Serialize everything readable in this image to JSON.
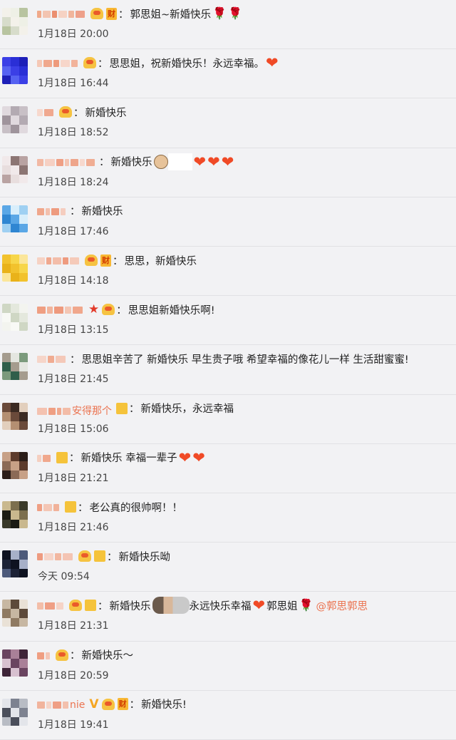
{
  "comments": [
    {
      "name_hint": "",
      "badges": [
        "vip",
        "cai"
      ],
      "text": "郭思姐~新婚快乐",
      "emojis": [
        "rose",
        "rose"
      ],
      "time": "1月18日 20:00",
      "avatar": [
        "#f3f1ea",
        "#d7dccb",
        "#b8c4a0",
        "#eef0e6"
      ],
      "name_blocks": [
        "#f0a98a",
        "#f3c4b1",
        "#eb8f70",
        "#f6d2c3",
        "#f1b59c",
        "#eea08a"
      ]
    },
    {
      "name_hint": "",
      "badges": [
        "vip"
      ],
      "text": "思思姐，祝新婚快乐！永远幸福。",
      "emojis": [
        "heart"
      ],
      "time": "1月18日 16:44",
      "avatar": [
        "#2a2fd6",
        "#3b3fe6",
        "#5662f2",
        "#1d1fb8"
      ],
      "name_blocks": [
        "#f5c8b6",
        "#f0a88d",
        "#ee9a7c",
        "#f7d6ca",
        "#f2b39b"
      ]
    },
    {
      "name_hint": "",
      "badges": [
        "vip"
      ],
      "text": "新婚快乐",
      "emojis": [],
      "time": "1月18日 18:52",
      "avatar": [
        "#c8c0c6",
        "#b3aab2",
        "#e0d9de",
        "#9f949c"
      ],
      "name_blocks": [
        "#f7d8cd",
        "#f0a88f"
      ]
    },
    {
      "name_hint": "",
      "badges": [],
      "text": "新婚快乐",
      "emojis": [
        "face",
        "whitebox",
        "heart",
        "heart",
        "heart"
      ],
      "time": "1月18日 18:24",
      "avatar": [
        "#e8dede",
        "#b9a3a2",
        "#8c7573",
        "#f1e9ea"
      ],
      "name_blocks": [
        "#f2b9a4",
        "#f6d0c3",
        "#ef9f84",
        "#f4c4b2",
        "#eea58b",
        "#f7d8cd",
        "#f0ad93"
      ]
    },
    {
      "name_hint": "",
      "badges": [],
      "text": "新婚快乐",
      "emojis": [],
      "time": "1月18日 17:46",
      "avatar": [
        "#5aa7e6",
        "#2f86d2",
        "#9fd0f2",
        "#d8eefb"
      ],
      "name_blocks": [
        "#f0a78c",
        "#f3c0ad",
        "#ee9b7f",
        "#f5cdbf"
      ]
    },
    {
      "name_hint": "",
      "badges": [
        "vip",
        "cai"
      ],
      "text": "思思，新婚快乐",
      "emojis": [],
      "time": "1月18日 14:18",
      "avatar": [
        "#f7d64a",
        "#f2c22d",
        "#e9b21a",
        "#fbe69a"
      ],
      "name_blocks": [
        "#f6d2c4",
        "#f0a88e",
        "#f3bda9",
        "#ee9b7f",
        "#f5cab9"
      ]
    },
    {
      "name_hint": "",
      "badges": [
        "star",
        "vip"
      ],
      "text": "思思姐新婚快乐啊!",
      "emojis": [],
      "time": "1月18日 13:15",
      "avatar": [
        "#f3f4ef",
        "#e4e8dd",
        "#cfd7c4",
        "#f8f9f5"
      ],
      "name_blocks": [
        "#ef9e82",
        "#f2b49c",
        "#ee9a7e",
        "#f4c6b4",
        "#f0a78c"
      ]
    },
    {
      "name_hint": "",
      "badges": [],
      "text": "思思姐辛苦了 新婚快乐  早生贵子哦  希望幸福的像花儿一样 生活甜蜜蜜!",
      "emojis": [],
      "time": "1月18日 21:45",
      "avatar": [
        "#2f5e4a",
        "#7b9a7c",
        "#e4e6e0",
        "#a59c8e"
      ],
      "name_blocks": [
        "#f6d5c9",
        "#f0ab91",
        "#f4c8b8"
      ]
    },
    {
      "name_hint": "",
      "badges": [
        "sq"
      ],
      "text": "新婚快乐，永远幸福",
      "emojis": [],
      "time": "1月18日 15:06",
      "avatar": [
        "#6a4a3a",
        "#b48f72",
        "#e2cfbd",
        "#3b2a22"
      ],
      "name_blocks": [
        "#f4c2b0",
        "#ef9f83",
        "#f0a88e",
        "#f3bca7"
      ],
      "name_text": "安得那个"
    },
    {
      "name_hint": "",
      "badges": [
        "sq"
      ],
      "text": "新婚快乐 幸福一辈子",
      "emojis": [
        "heart",
        "heart"
      ],
      "time": "1月18日 21:21",
      "avatar": [
        "#5c3b2c",
        "#c7a086",
        "#8b6a56",
        "#2b1d18"
      ],
      "name_blocks": [
        "#f5cfc0",
        "#f0a88d"
      ]
    },
    {
      "name_hint": "",
      "badges": [
        "sq"
      ],
      "text": "老公真的很帅啊！！",
      "emojis": [],
      "time": "1月18日 21:46",
      "avatar": [
        "#3a3a2a",
        "#7c6f4e",
        "#c9b88e",
        "#1b1b14"
      ],
      "name_blocks": [
        "#ef9f84",
        "#f4c6b5",
        "#f1b29a"
      ]
    },
    {
      "name_hint": "",
      "badges": [
        "vip",
        "sq"
      ],
      "text": "新婚快乐呦",
      "emojis": [],
      "time": "今天 09:54",
      "avatar": [
        "#1c2236",
        "#4d5a7a",
        "#a7b0c8",
        "#0e1220"
      ],
      "name_blocks": [
        "#ee9b80",
        "#f6d4c8",
        "#f2b7a0",
        "#f4c4b3"
      ]
    },
    {
      "name_hint": "",
      "badges": [
        "vip",
        "sq"
      ],
      "text": "新婚快乐",
      "text2": "永远快乐幸福",
      "text3": "郭思姐",
      "mention": "@郭思郭思",
      "emojis": [],
      "time": "1月18日 21:31",
      "avatar": [
        "#c7b7a2",
        "#8f7a62",
        "#e9e1d6",
        "#5d4a3a"
      ],
      "name_blocks": [
        "#f3bea9",
        "#ef9f85",
        "#f6d3c6"
      ]
    },
    {
      "name_hint": "",
      "badges": [
        "vip"
      ],
      "text": "新婚快乐～",
      "emojis": [],
      "time": "1月18日 20:59",
      "avatar": [
        "#a98098",
        "#6a4460",
        "#d7c0cf",
        "#3e2438"
      ],
      "name_blocks": [
        "#ef9e82",
        "#f4c6b6"
      ]
    },
    {
      "name_hint": "",
      "badges": [
        "v",
        "vip",
        "cai"
      ],
      "text": "新婚快乐!",
      "emojis": [],
      "time": "1月18日 19:41",
      "avatar": [
        "#b8bcc4",
        "#7d8290",
        "#e3e5ea",
        "#4b4f5b"
      ],
      "name_blocks": [
        "#f1b49d",
        "#f6d4c7",
        "#ef9f85",
        "#f3c0ad"
      ],
      "name_text": "nie"
    }
  ],
  "labels": {
    "cai": "财",
    "colon": "："
  },
  "icons": {
    "vip": "vip-crown-icon",
    "cai": "wealth-badge-icon",
    "sq": "member-badge-icon",
    "v": "verified-v-icon",
    "star": "star-icon",
    "heart": "heart-emoji-icon",
    "rose": "rose-emoji-icon"
  }
}
